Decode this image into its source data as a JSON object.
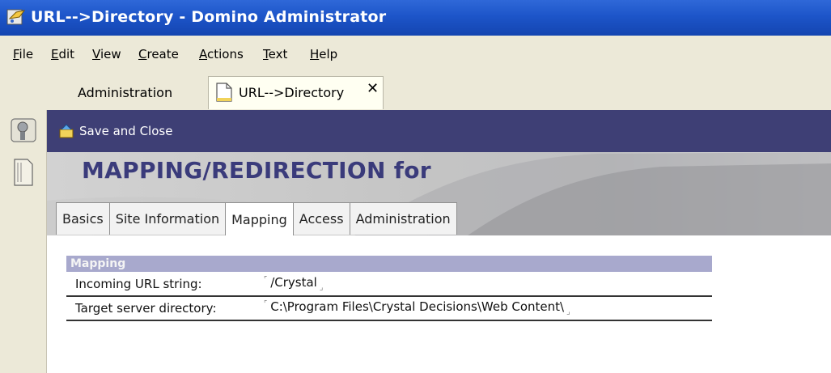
{
  "window": {
    "title": "URL-->Directory - Domino Administrator"
  },
  "menu": [
    "File",
    "Edit",
    "View",
    "Create",
    "Actions",
    "Text",
    "Help"
  ],
  "tabs": {
    "admin": "Administration",
    "doc": "URL-->Directory",
    "close": "✕"
  },
  "action": {
    "save_close": "Save and Close"
  },
  "form": {
    "heading": "MAPPING/REDIRECTION for",
    "tabs": [
      "Basics",
      "Site Information",
      "Mapping",
      "Access",
      "Administration"
    ],
    "active_tab": "Mapping"
  },
  "section": {
    "title": "Mapping",
    "rows": [
      {
        "label": "Incoming URL string:",
        "value": "/Crystal"
      },
      {
        "label": "Target server directory:",
        "value": "C:\\Program Files\\Crystal Decisions\\Web Content\\"
      }
    ]
  },
  "colors": {
    "title_bar": "#1d55c9",
    "action_bar": "#3e3f75",
    "heading": "#3a3b7b",
    "section_head": "#a8a9cd"
  }
}
